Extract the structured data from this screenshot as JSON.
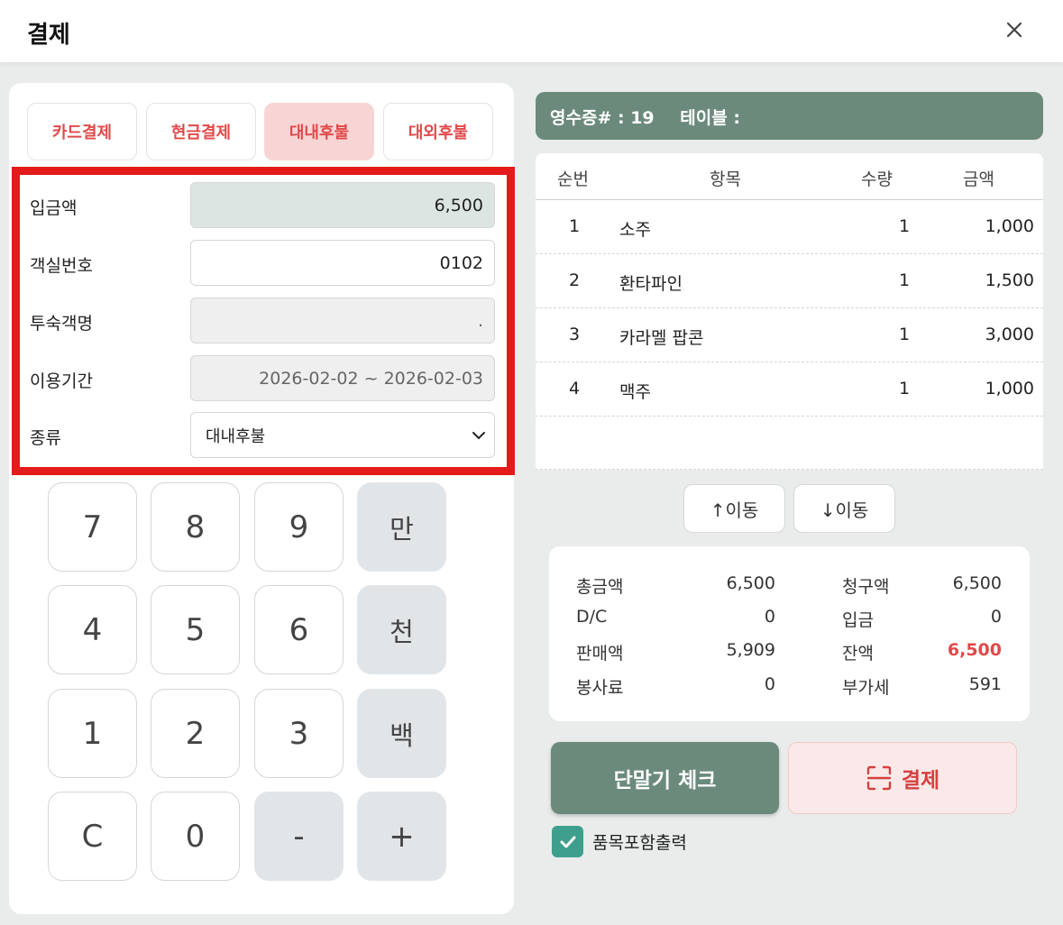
{
  "header": {
    "title": "결제"
  },
  "tabs": [
    {
      "label": "카드결제",
      "active": false
    },
    {
      "label": "현금결제",
      "active": false
    },
    {
      "label": "대내후불",
      "active": true
    },
    {
      "label": "대외후불",
      "active": false
    }
  ],
  "form": {
    "deposit_label": "입금액",
    "deposit_value": "6,500",
    "room_label": "객실번호",
    "room_value": "0102",
    "guest_label": "투숙객명",
    "guest_value": ".",
    "period_label": "이용기간",
    "period_value": "2026-02-02 ~ 2026-02-03",
    "type_label": "종류",
    "type_value": "대내후불"
  },
  "keypad": [
    "7",
    "8",
    "9",
    "만",
    "4",
    "5",
    "6",
    "천",
    "1",
    "2",
    "3",
    "백",
    "C",
    "0",
    "-",
    "+"
  ],
  "receipt": {
    "number_label": "영수증# : 19",
    "table_label": "테이블 :"
  },
  "table": {
    "headers": [
      "순번",
      "항목",
      "수량",
      "금액"
    ],
    "rows": [
      {
        "no": "1",
        "item": "소주",
        "qty": "1",
        "amount": "1,000"
      },
      {
        "no": "2",
        "item": "환타파인",
        "qty": "1",
        "amount": "1,500"
      },
      {
        "no": "3",
        "item": "카라멜 팝콘",
        "qty": "1",
        "amount": "3,000"
      },
      {
        "no": "4",
        "item": "맥주",
        "qty": "1",
        "amount": "1,000"
      }
    ]
  },
  "move": {
    "up_label": "↑이동",
    "down_label": "↓이동"
  },
  "summary": {
    "total_label": "총금액",
    "total_value": "6,500",
    "dc_label": "D/C",
    "dc_value": "0",
    "sales_label": "판매액",
    "sales_value": "5,909",
    "service_label": "봉사료",
    "service_value": "0",
    "billed_label": "청구액",
    "billed_value": "6,500",
    "paid_label": "입금",
    "paid_value": "0",
    "balance_label": "잔액",
    "balance_value": "6,500",
    "vat_label": "부가세",
    "vat_value": "591"
  },
  "actions": {
    "check_label": "단말기 체크",
    "pay_label": "결제"
  },
  "print_option": {
    "label": "품목포함출력",
    "checked": true
  },
  "colors": {
    "accent_green": "#6b8a7c",
    "accent_red": "#e04a4a",
    "highlight_border": "#e31b1b",
    "checkbox": "#3ea08c"
  }
}
